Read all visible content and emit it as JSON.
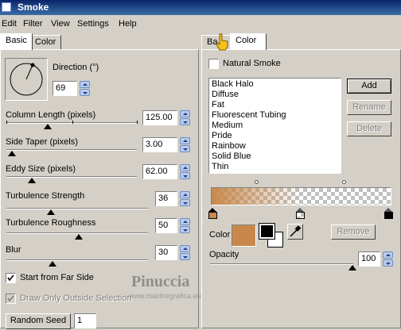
{
  "window": {
    "title": "Smoke"
  },
  "menu": [
    "Edit",
    "Filter",
    "View",
    "Settings",
    "Help"
  ],
  "left_tabs": {
    "basic": "Basic",
    "color": "Color"
  },
  "direction": {
    "label": "Direction (°)",
    "value": "69"
  },
  "column_length": {
    "label": "Column Length (pixels)",
    "value": "125.00"
  },
  "side_taper": {
    "label": "Side Taper (pixels)",
    "value": "3.00"
  },
  "eddy_size": {
    "label": "Eddy Size (pixels)",
    "value": "62.00"
  },
  "turbulence_strength": {
    "label": "Turbulence Strength",
    "value": "36"
  },
  "turbulence_roughness": {
    "label": "Turbulence Roughness",
    "value": "50"
  },
  "blur": {
    "label": "Blur",
    "value": "30"
  },
  "start_far_side": {
    "label": "Start from Far Side",
    "checked": true
  },
  "draw_outside": {
    "label": "Draw Only Outside Selection",
    "checked": true,
    "disabled": true
  },
  "random_seed": {
    "label": "Random Seed",
    "value": "1"
  },
  "right_tabs": {
    "basic": "Ba",
    "color": "Color"
  },
  "natural_smoke": {
    "label": "Natural Smoke",
    "checked": false
  },
  "presets": [
    "Black Halo",
    "Diffuse",
    "Fat",
    "Fluorescent Tubing",
    "Medium",
    "Pride",
    "Rainbow",
    "Solid Blue",
    "Thin"
  ],
  "preset_buttons": {
    "add": "Add",
    "rename": "Rename",
    "delete": "Delete"
  },
  "color_label": "Color",
  "remove_label": "Remove",
  "opacity": {
    "label": "Opacity",
    "value": "100"
  },
  "colors": {
    "swatch": "#c8884c",
    "gradient_start": "#c8884c",
    "primary": "#000000",
    "secondary": "#ffffff"
  },
  "watermark": {
    "name": "Pinuccia",
    "url": "www.maidiregrafica.eu"
  }
}
